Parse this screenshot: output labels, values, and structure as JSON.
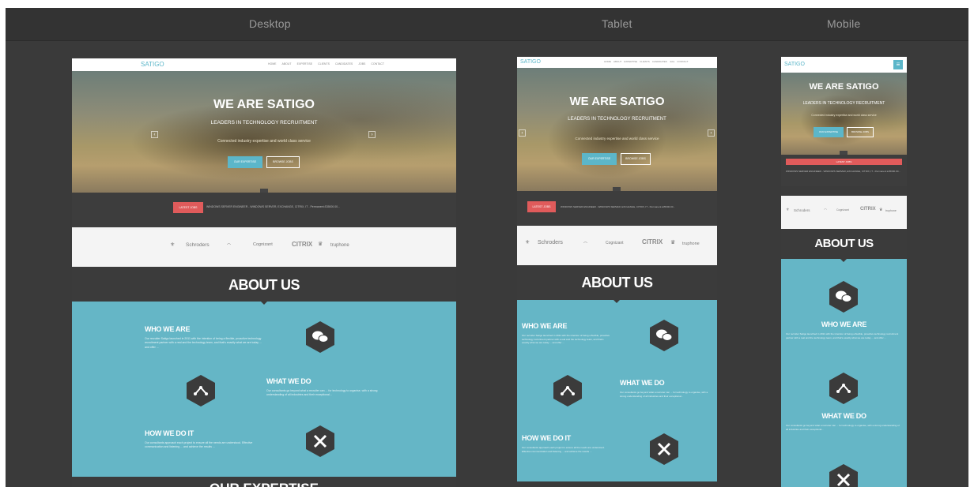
{
  "devices": {
    "desktop": "Desktop",
    "tablet": "Tablet",
    "mobile": "Mobile"
  },
  "site": {
    "logo": "SATIGO",
    "nav": [
      "HOME",
      "ABOUT",
      "EXPERTISE",
      "CLIENTS",
      "CANDIDATES",
      "JOBS",
      "CONTACT"
    ],
    "nav_tablet": [
      "HOME",
      "ABOUT",
      "EXPERTISE",
      "CLIENTS",
      "CANDIDATES",
      "Jobs",
      "CONTACT"
    ],
    "hero_title": "WE ARE SATIGO",
    "hero_subtitle": "LEADERS IN TECHNOLOGY RECRUITMENT",
    "hero_tagline": "Connected industry expertise and world class service",
    "btn_expertise": "OUR EXPERTISE",
    "btn_jobs": "BROWSE JOBS",
    "latest_label": "LATEST JOBS",
    "latest_text": "WINDOWS SERVER ENGINEER - WINDOWS SERVER, EXCHANGE, CITRIX, IT - Permanent £35000.00...",
    "clients": [
      "Schroders",
      "Cognizant",
      "CITRIX",
      "truphone"
    ],
    "about_title": "ABOUT US",
    "who_title": "WHO WE ARE",
    "who_body": "Our recruiter Satigo launched in 2011 with the intention of being a flexible, proactive technology recruitment partner with a real and the technology team, and that's exactly what we are today ... and offer ...",
    "what_title": "WHAT WE DO",
    "what_body": "Our consultants go beyond what a recruiter can ... for technology to organise, with a strong understanding of all industries and their exceptional...",
    "how_title": "HOW WE DO IT",
    "how_body": "Our consultants approach each project to ensure all the needs are understood. Effective communication and listening ... and achieve the results ...",
    "expertise_title": "OUR EXPERTISE"
  },
  "colors": {
    "teal": "#65b6c6",
    "dark": "#3b3b3b",
    "red": "#e05b5b",
    "accent": "#5cb6c9"
  },
  "icons": [
    "chat-bubbles-icon",
    "network-icon",
    "tools-icon"
  ]
}
